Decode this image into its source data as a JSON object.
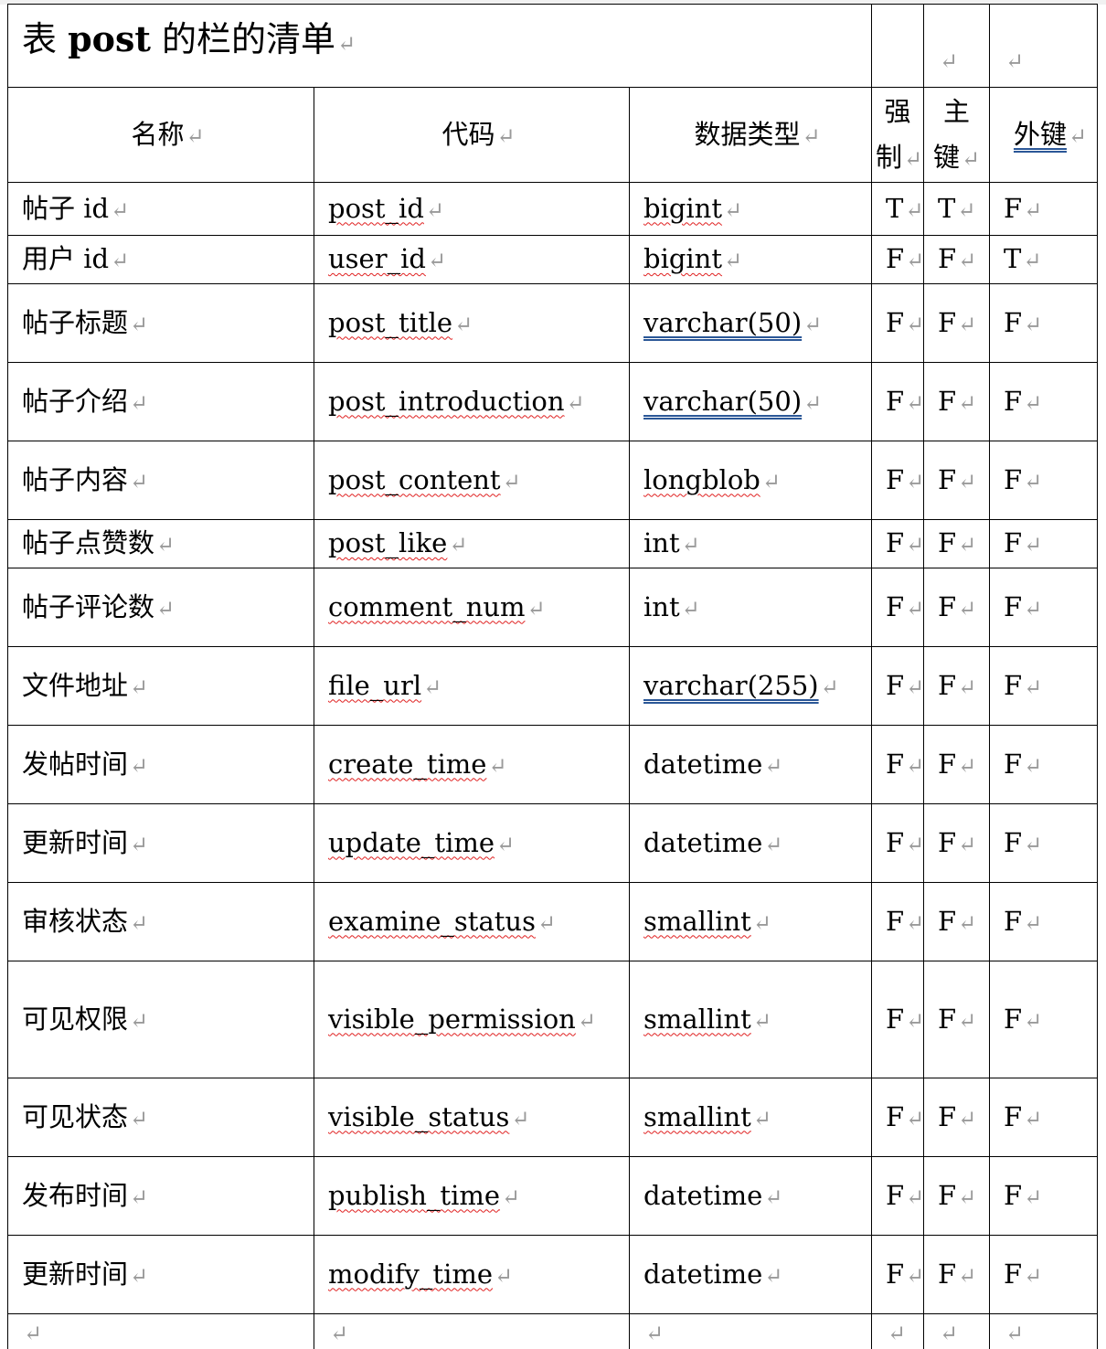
{
  "table": {
    "title_prefix": "表 ",
    "title_bold": "post",
    "title_suffix": " 的栏的清单",
    "para_mark": "↵",
    "headers": {
      "name": "名称",
      "code": "代码",
      "type": "数据类型",
      "mandatory_top": "强",
      "mandatory_bottom": "制",
      "primary_top": "主",
      "primary_bottom": "键",
      "foreign": "外键"
    },
    "rows": [
      {
        "name": "帖子 id",
        "code": "post_id",
        "type": "bigint",
        "m": "T",
        "p": "T",
        "f": "F"
      },
      {
        "name": "用户 id",
        "code": "user_id",
        "type": "bigint",
        "m": "F",
        "p": "F",
        "f": "T"
      },
      {
        "name": "帖子标题",
        "code": "post_title",
        "type": "varchar(50)",
        "m": "F",
        "p": "F",
        "f": "F"
      },
      {
        "name": "帖子介绍",
        "code": "post_introduction",
        "type": "varchar(50)",
        "m": "F",
        "p": "F",
        "f": "F"
      },
      {
        "name": "帖子内容",
        "code": "post_content",
        "type": "longblob",
        "m": "F",
        "p": "F",
        "f": "F"
      },
      {
        "name": "帖子点赞数",
        "code": "post_like",
        "type": "int",
        "m": "F",
        "p": "F",
        "f": "F"
      },
      {
        "name": "帖子评论数",
        "code": "comment_num",
        "type": "int",
        "m": "F",
        "p": "F",
        "f": "F"
      },
      {
        "name": "文件地址",
        "code": "file_url",
        "type": "varchar(255)",
        "m": "F",
        "p": "F",
        "f": "F"
      },
      {
        "name": "发帖时间",
        "code": "create_time",
        "type": "datetime",
        "m": "F",
        "p": "F",
        "f": "F"
      },
      {
        "name": "更新时间",
        "code": "update_time",
        "type": "datetime",
        "m": "F",
        "p": "F",
        "f": "F"
      },
      {
        "name": "审核状态",
        "code": "examine_status",
        "type": "smallint",
        "m": "F",
        "p": "F",
        "f": "F"
      },
      {
        "name": "可见权限",
        "code": "visible_permission",
        "type": "smallint",
        "m": "F",
        "p": "F",
        "f": "F"
      },
      {
        "name": "可见状态",
        "code": "visible_status",
        "type": "smallint",
        "m": "F",
        "p": "F",
        "f": "F"
      },
      {
        "name": "发布时间",
        "code": "publish_time",
        "type": "datetime",
        "m": "F",
        "p": "F",
        "f": "F"
      },
      {
        "name": "更新时间",
        "code": "modify_time",
        "type": "datetime",
        "m": "F",
        "p": "F",
        "f": "F"
      }
    ]
  }
}
